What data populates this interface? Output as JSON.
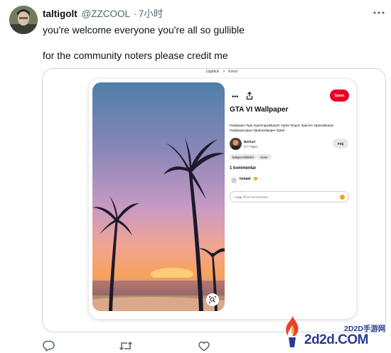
{
  "tweet": {
    "display_name": "taltigolt",
    "handle": "@ZZCOOL",
    "separator": "·",
    "time": "7小时",
    "line1": "you're welcome everyone you're all so gullible",
    "line2": "for the community noters please credit me"
  },
  "embedded_pin": {
    "breadcrumb": [
      "Upptäck",
      ">",
      "Konst"
    ],
    "save_label": "Spara",
    "title": "GTA VI Wallpaper",
    "tags": "#wallpaper #gta #gamingwallpaper #gtavi #jogos #games #gtawallpaper #wallpapergtavi #gtabwallpaper #gta6",
    "author_name": "Berhart",
    "author_followers": "377 följare",
    "follow_label": "Följ",
    "chips": [
      "Bakgrundsbilder",
      "Natur"
    ],
    "comment_count": "1 kommentar",
    "commenter_name": "Ismael",
    "commenter_sub": "...",
    "comment_placeholder": "Lägg till en kommentar"
  },
  "actions": {
    "icons": [
      "reply-icon",
      "retweet-icon",
      "like-icon"
    ]
  },
  "watermark": {
    "small": "2D2D手游网",
    "big": "2d2d.COM"
  },
  "colors": {
    "save_red": "#e60023",
    "watermark_blue": "#2a3b8f",
    "handle_gray": "#536471"
  }
}
